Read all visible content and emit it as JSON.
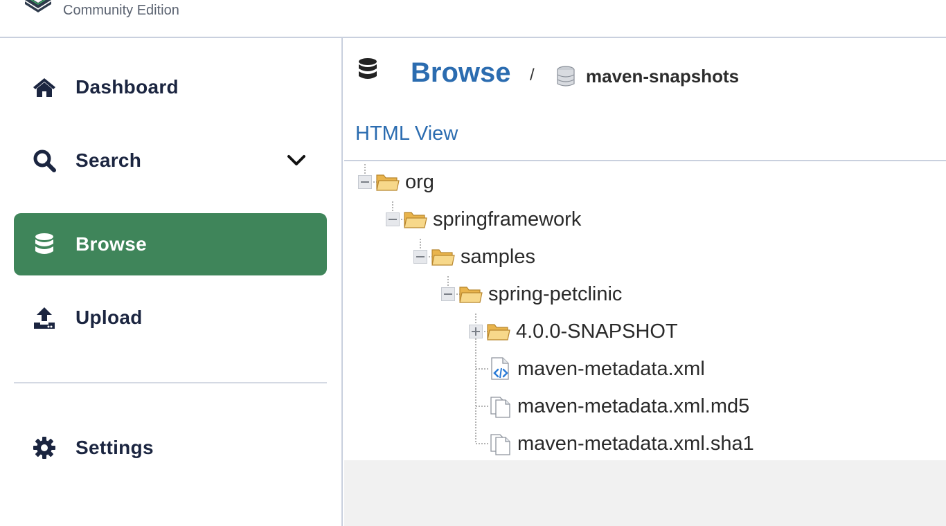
{
  "header": {
    "edition": "Community Edition"
  },
  "sidebar": {
    "items": [
      {
        "label": "Dashboard",
        "icon": "home-icon"
      },
      {
        "label": "Search",
        "icon": "search-icon"
      },
      {
        "label": "Browse",
        "icon": "database-icon"
      },
      {
        "label": "Upload",
        "icon": "upload-icon"
      },
      {
        "label": "Settings",
        "icon": "gear-icon"
      }
    ],
    "active_color": "#3f855a"
  },
  "main": {
    "breadcrumb": {
      "title": "Browse",
      "separator": "/",
      "repository": "maven-snapshots"
    },
    "html_view_label": "HTML View",
    "tree": [
      {
        "label": "org",
        "type": "folder",
        "expanded": true
      },
      {
        "label": "springframework",
        "type": "folder",
        "expanded": true
      },
      {
        "label": "samples",
        "type": "folder",
        "expanded": true
      },
      {
        "label": "spring-petclinic",
        "type": "folder",
        "expanded": true
      },
      {
        "label": "4.0.0-SNAPSHOT",
        "type": "folder",
        "expanded": false
      },
      {
        "label": "maven-metadata.xml",
        "type": "xml-file"
      },
      {
        "label": "maven-metadata.xml.md5",
        "type": "file"
      },
      {
        "label": "maven-metadata.xml.sha1",
        "type": "file"
      }
    ],
    "link_color": "#2b6cb0"
  }
}
